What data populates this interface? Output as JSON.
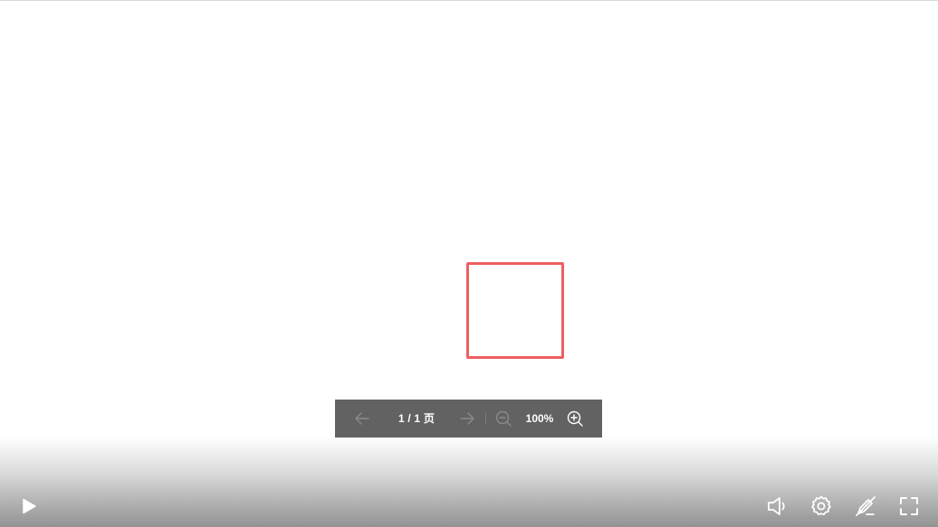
{
  "doc_toolbar": {
    "page_indicator": "1 / 1 页",
    "zoom_level": "100%",
    "icons": {
      "prev": "arrow-left-icon",
      "next": "arrow-right-icon",
      "zoom_out": "zoom-out-icon",
      "zoom_in": "zoom-in-icon"
    }
  },
  "control_bar": {
    "icons": {
      "play": "play-icon",
      "volume": "volume-icon",
      "settings": "gear-icon",
      "annotation": "pen-slash-icon",
      "fullscreen": "fullscreen-icon"
    }
  },
  "colors": {
    "highlight_border": "#ee5f63",
    "toolbar_bg": "#626262",
    "icon_disabled": "#8a8a8a",
    "icon_active": "#ffffff"
  }
}
